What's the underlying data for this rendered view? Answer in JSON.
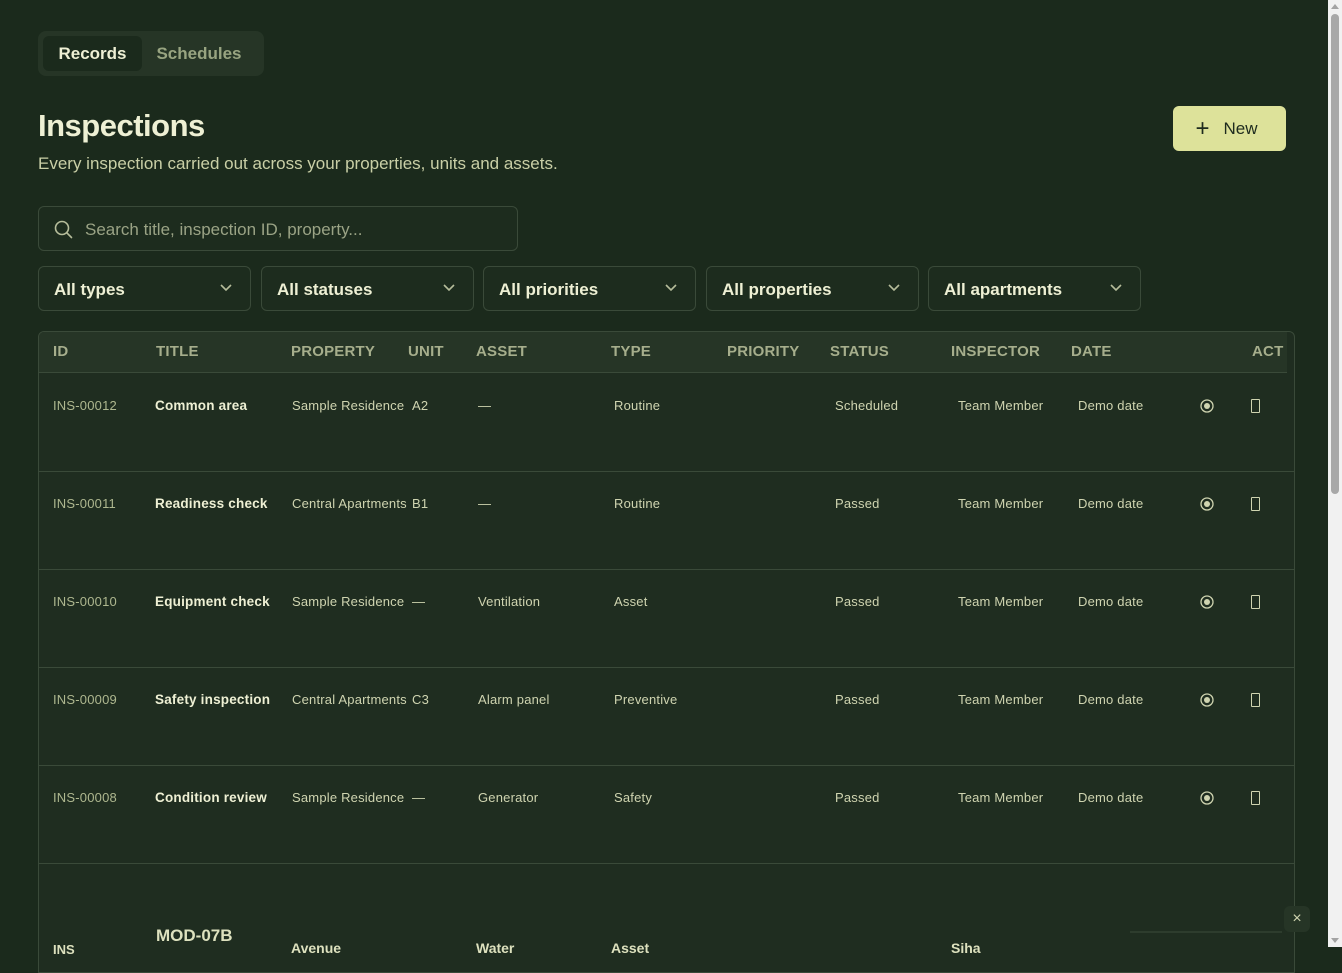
{
  "tabs": [
    {
      "label": "Records",
      "active": true
    },
    {
      "label": "Schedules",
      "active": false
    }
  ],
  "page": {
    "title": "Inspections",
    "subtitle": "Every inspection carried out across your properties, units and assets."
  },
  "new_button": {
    "label": "New",
    "icon": "plus-icon"
  },
  "search": {
    "placeholder": "Search title, inspection ID, property...",
    "icon": "search-icon"
  },
  "filters": [
    {
      "label": "All types"
    },
    {
      "label": "All statuses"
    },
    {
      "label": "All priorities"
    },
    {
      "label": "All properties"
    },
    {
      "label": "All apartments"
    }
  ],
  "table": {
    "columns": [
      "ID",
      "TITLE",
      "PROPERTY",
      "UNIT",
      "ASSET",
      "TYPE",
      "PRIORITY",
      "STATUS",
      "INSPECTOR",
      "DATE",
      "ACT"
    ],
    "rows": [
      {
        "id": "INS-00012",
        "title": "Common area",
        "property": "Sample Residence",
        "unit": "A2",
        "asset": "—",
        "type": "Routine",
        "priority": "",
        "status": "Scheduled",
        "inspector": "Team Member",
        "date": "Demo date"
      },
      {
        "id": "INS-00011",
        "title": "Readiness check",
        "property": "Central Apartments",
        "unit": "B1",
        "asset": "—",
        "type": "Routine",
        "priority": "",
        "status": "Passed",
        "inspector": "Team Member",
        "date": "Demo date"
      },
      {
        "id": "INS-00010",
        "title": "Equipment check",
        "property": "Sample Residence",
        "unit": "—",
        "asset": "Ventilation",
        "type": "Asset",
        "priority": "",
        "status": "Passed",
        "inspector": "Team Member",
        "date": "Demo date"
      },
      {
        "id": "INS-00009",
        "title": "Safety inspection",
        "property": "Central Apartments",
        "unit": "C3",
        "asset": "Alarm panel",
        "type": "Preventive",
        "priority": "",
        "status": "Passed",
        "inspector": "Team Member",
        "date": "Demo date"
      },
      {
        "id": "INS-00008",
        "title": "Condition review",
        "property": "Sample Residence",
        "unit": "—",
        "asset": "Generator",
        "type": "Safety",
        "priority": "",
        "status": "Passed",
        "inspector": "Team Member",
        "date": "Demo date"
      }
    ],
    "partial_row": {
      "id": "INS",
      "title": "MOD-07B",
      "property": "Avenue",
      "asset": "Water",
      "type": "Asset",
      "inspector": "Siha"
    }
  },
  "row_actions": {
    "view_icon": "eye-icon",
    "delete_icon": "trash-icon"
  },
  "close_label": "×",
  "colors": {
    "background": "#1b2a1c",
    "accent": "#dde29a",
    "border": "#3a4a39"
  }
}
